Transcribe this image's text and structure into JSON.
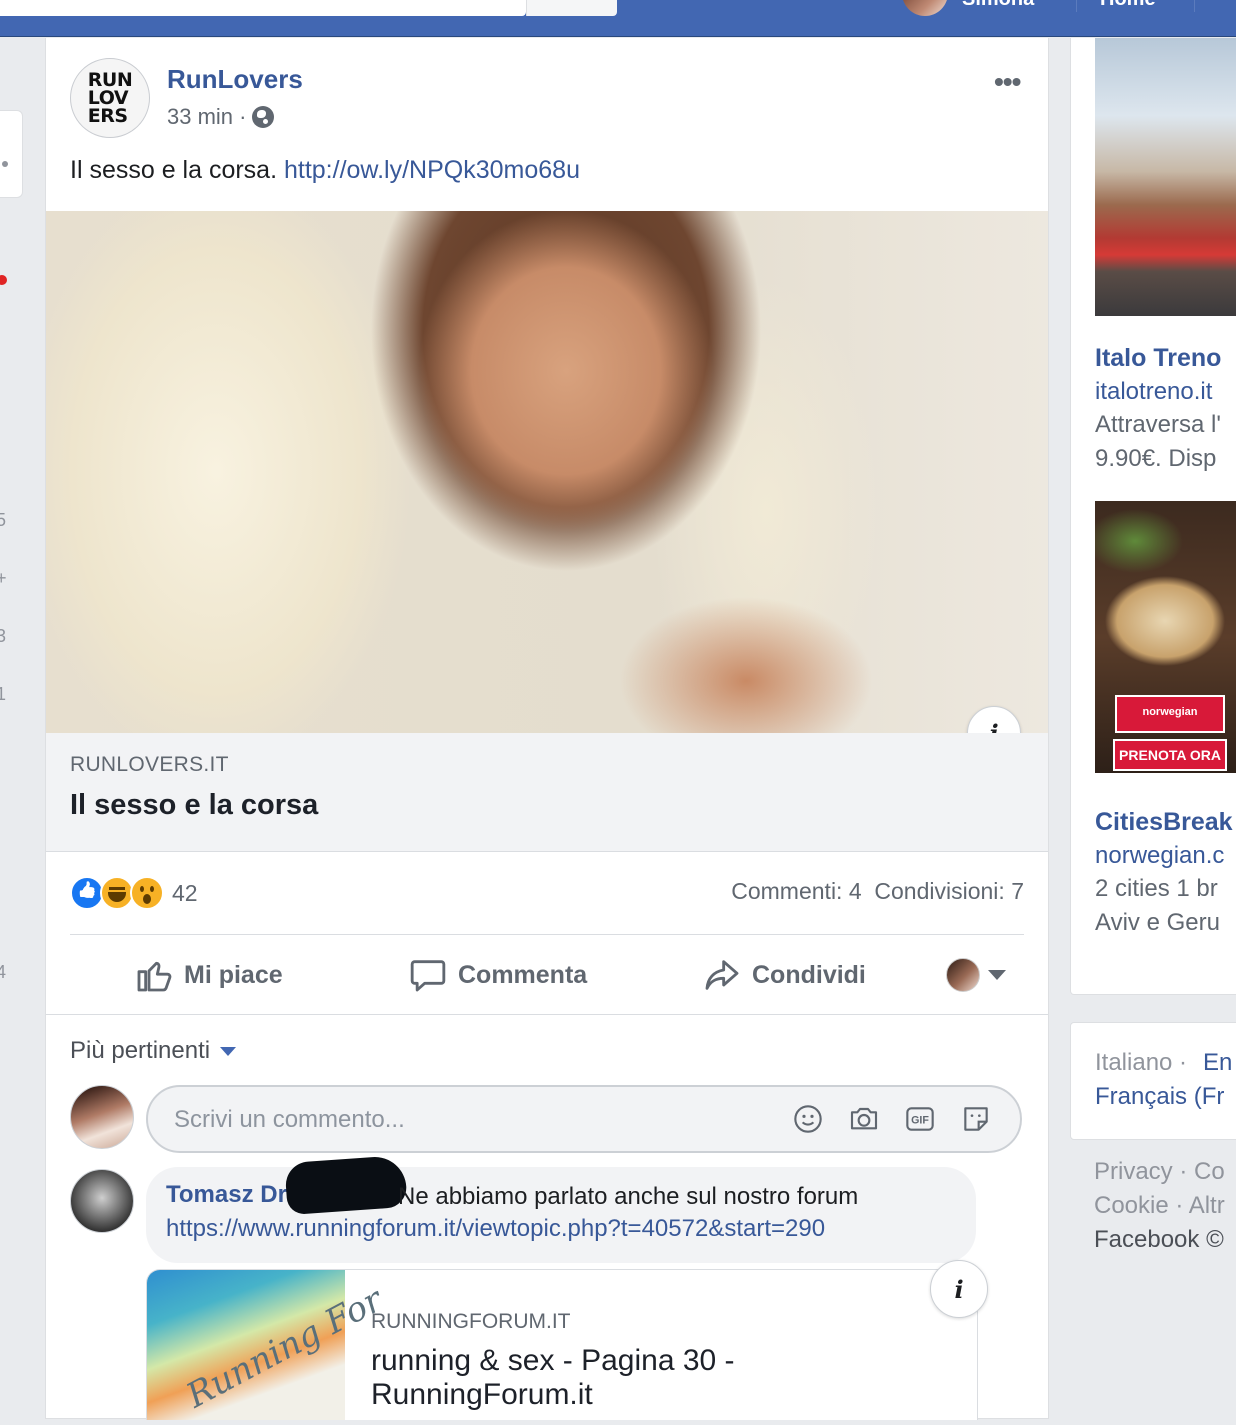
{
  "topbar": {
    "user_name": "Simona",
    "home_label": "Home"
  },
  "left_fragments": [
    "5",
    "+",
    "3",
    "1",
    "4"
  ],
  "post": {
    "page_name": "RunLovers",
    "avatar_logo": "RUN LOV ERS",
    "time": "33 min ·",
    "text": "Il sesso e la corsa.",
    "link": "http://ow.ly/NPQk30mo68u",
    "link_preview": {
      "domain": "RUNLOVERS.IT",
      "title": "Il sesso e la corsa"
    },
    "reaction_count": "42",
    "comments_count": "Commenti: 4",
    "shares_count": "Condivisioni: 7",
    "actions": {
      "like": "Mi piace",
      "comment": "Commenta",
      "share": "Condividi"
    }
  },
  "comments": {
    "sort_label": "Più pertinenti",
    "input_placeholder": "Scrivi un commento...",
    "items": [
      {
        "author": "Tomasz Dr",
        "text": "Ne abbiamo parlato anche sul nostro forum",
        "link": "https://www.runningforum.it/viewtopic.php?t=40572&start=290",
        "preview": {
          "domain": "RUNNINGFORUM.IT",
          "title": "running & sex - Pagina 30 - RunningForum.it",
          "thumb_text": "Running For"
        }
      }
    ]
  },
  "sidebar": {
    "ads": [
      {
        "title": "Italo Treno",
        "domain": "italotreno.it",
        "text_lines": [
          "Attraversa l'",
          "9.90€. Disp"
        ]
      },
      {
        "title": "CitiesBreak",
        "domain": "norwegian.c",
        "text_lines": [
          "2 cities 1 br",
          "Aviv e Geru"
        ],
        "badge": "norwegian",
        "cta": "PRENOTA ORA ▶"
      }
    ],
    "languages": {
      "line1_current": "Italiano · ",
      "line1_link": "En",
      "line2_link": "Français (Fr"
    },
    "footer": [
      "Privacy · Co",
      "Cookie · Altr",
      "Facebook ©"
    ]
  },
  "colors": {
    "brand_blue": "#4267b2",
    "link_blue": "#385898",
    "muted": "#606770",
    "like_blue": "#1877f2",
    "reaction_yellow": "#f7b125",
    "norwegian_red": "#d81939"
  }
}
